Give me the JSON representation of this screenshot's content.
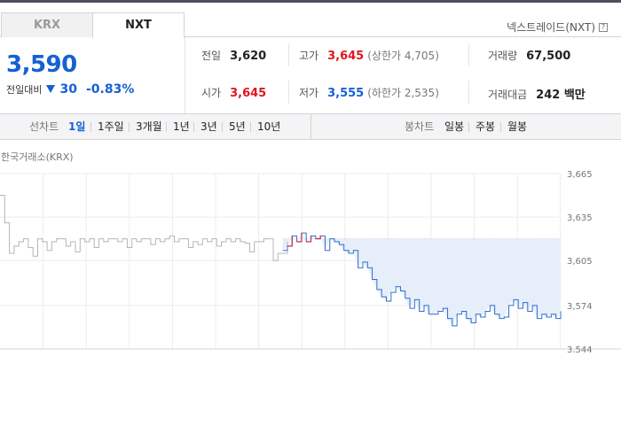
{
  "market_tabs": {
    "krx": "KRX",
    "nxt": "NXT"
  },
  "nextrade_link": "넥스트레이드(NXT)",
  "help_icon_glyph": "?",
  "quote": {
    "price": "3,590",
    "change_label": "전일대비",
    "change_value": "30",
    "change_pct": "-0.83%"
  },
  "stats": {
    "prev_close": {
      "label": "전일",
      "value": "3,620"
    },
    "open": {
      "label": "시가",
      "value": "3,645"
    },
    "high": {
      "label": "고가",
      "value": "3,645",
      "sub": "(상한가 4,705)"
    },
    "low": {
      "label": "저가",
      "value": "3,555",
      "sub": "(하한가 2,535)"
    },
    "volume": {
      "label": "거래량",
      "value": "67,500"
    },
    "amount": {
      "label": "거래대금",
      "value": "242 백만"
    }
  },
  "toolbar": {
    "line_label": "선차트",
    "periods": [
      "1일",
      "1주일",
      "3개월",
      "1년",
      "3년",
      "5년",
      "10년"
    ],
    "active_period": "1일",
    "candle_label": "봉차트",
    "candles": [
      "일봉",
      "주봉",
      "월봉"
    ]
  },
  "colors": {
    "accent_blue": "#1560d4",
    "up_red": "#e0161e",
    "krx_line": "#b5b5b5",
    "nxt_line": "#2f6fce",
    "area_fill": "#e6eefa"
  },
  "chart_data": {
    "type": "line",
    "market_label": "한국거래소(KRX)",
    "y_ticks": [
      "3,665",
      "3,635",
      "3,605",
      "3,574",
      "3,544"
    ],
    "ylim": [
      3544,
      3665
    ],
    "base_line": 3620,
    "x_points": 120,
    "series": [
      {
        "values": [
          3650,
          3631,
          3610,
          3615,
          3618,
          3620,
          3614,
          3608,
          3620,
          3618,
          3612,
          3618,
          3620,
          3620,
          3615,
          3618,
          3611,
          3620,
          3618,
          3620,
          3614,
          3620,
          3618,
          3620,
          3620,
          3618,
          3620,
          3614,
          3620,
          3618,
          3620,
          3620,
          3616,
          3620,
          3618,
          3620,
          3622,
          3618,
          3620,
          3620,
          3614,
          3618,
          3616,
          3620,
          3618,
          3620,
          3615,
          3618,
          3620,
          3618,
          3620,
          3618,
          3617,
          3611,
          3618,
          3618,
          3620,
          3620,
          3605,
          3610,
          3610,
          3618
        ],
        "x_start": 0
      },
      {
        "values": [
          3612,
          3615,
          3622,
          3618,
          3624,
          3618,
          3622,
          3620,
          3622,
          3612,
          3620,
          3618,
          3616,
          3612,
          3610,
          3612,
          3600,
          3604,
          3600,
          3592,
          3585,
          3580,
          3577,
          3583,
          3587,
          3584,
          3579,
          3572,
          3578,
          3570,
          3574,
          3568,
          3568,
          3570,
          3572,
          3565,
          3560,
          3568,
          3570,
          3565,
          3562,
          3568,
          3566,
          3570,
          3574,
          3568,
          3565,
          3566,
          3574,
          3578,
          3572,
          3576,
          3570,
          3574,
          3565,
          3568,
          3566,
          3568,
          3565,
          3570
        ],
        "x_start": 60,
        "highlight_red_indices": [
          2,
          4,
          6,
          8
        ]
      }
    ]
  }
}
